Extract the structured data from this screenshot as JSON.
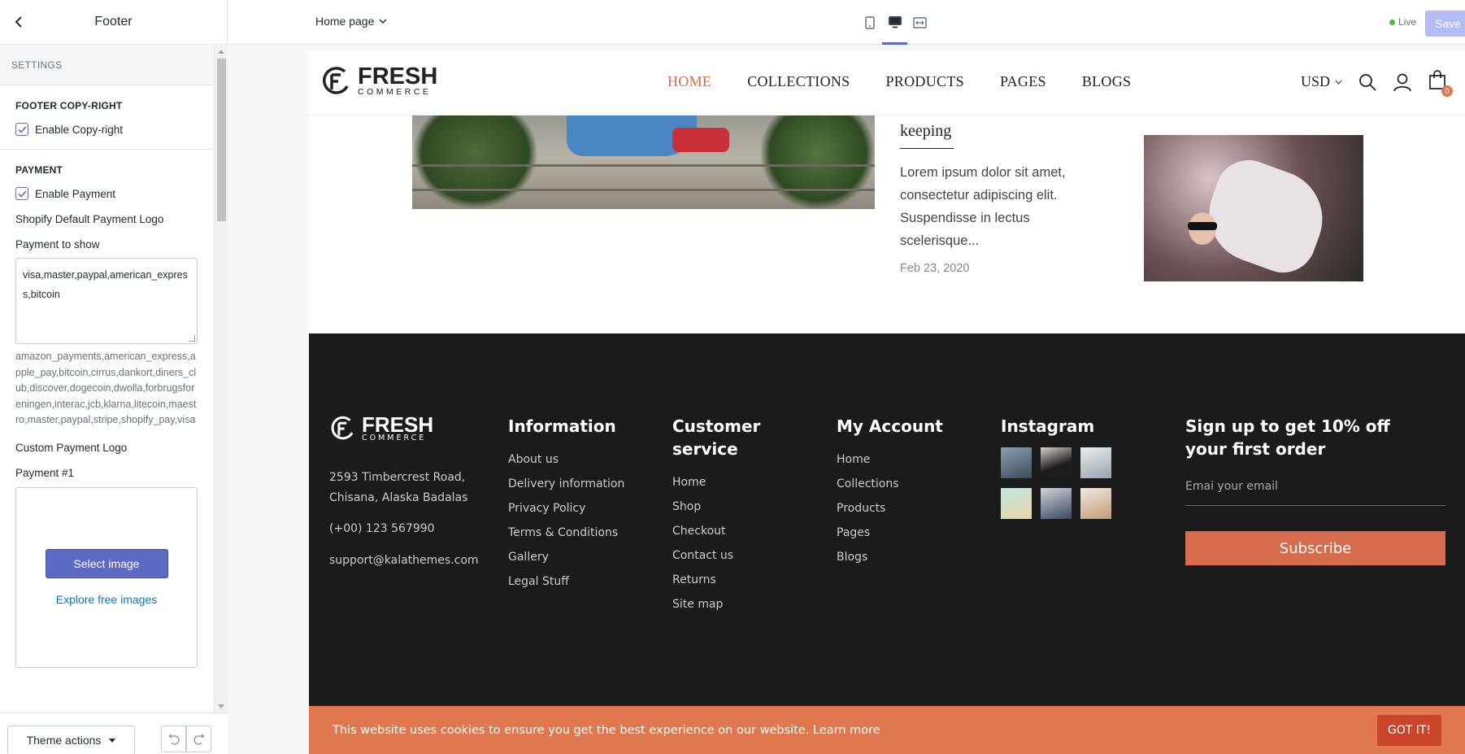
{
  "sidebar": {
    "title": "Footer",
    "settings_label": "SETTINGS",
    "copyright_section": {
      "heading": "FOOTER COPY-RIGHT",
      "checkbox_label": "Enable Copy-right"
    },
    "payment_section": {
      "heading": "PAYMENT",
      "checkbox_label": "Enable Payment",
      "default_logo_label": "Shopify Default Payment Logo",
      "payment_to_show_label": "Payment to show",
      "payment_to_show_value": "visa,master,paypal,american_express,bitcoin",
      "hint": "amazon_payments,american_express,apple_pay,bitcoin,cirrus,dankort,diners_club,discover,dogecoin,dwolla,forbrugsforeningen,interac,jcb,klarna,litecoin,maestro,master,paypal,stripe,shopify_pay,visa",
      "custom_logo_label": "Custom Payment Logo",
      "payment1_label": "Payment #1",
      "select_image": "Select image",
      "explore_images": "Explore free images"
    },
    "theme_actions": "Theme actions"
  },
  "topbar": {
    "page_select": "Home page",
    "live_label": "Live",
    "save_label": "Save"
  },
  "preview": {
    "logo": {
      "big": "FRESH",
      "small": "COMMERCE"
    },
    "menu": [
      "HOME",
      "COLLECTIONS",
      "PRODUCTS",
      "PAGES",
      "BLOGS"
    ],
    "currency": "USD",
    "cart_count": "0",
    "blog": {
      "title": "keeping",
      "excerpt": "Lorem ipsum dolor sit amet, consectetur adipiscing elit. Suspendisse in lectus scelerisque...",
      "date": "Feb 23, 2020"
    },
    "footer": {
      "address": [
        "2593 Timbercrest Road,",
        "Chisana, Alaska Badalas"
      ],
      "phone": "(+00) 123 567990",
      "email": "support@kalathemes.com",
      "information": {
        "heading": "Information",
        "links": [
          "About us",
          "Delivery information",
          "Privacy Policy",
          "Terms & Conditions",
          "Gallery",
          "Legal Stuff"
        ]
      },
      "customer_service": {
        "heading": "Customer service",
        "links": [
          "Home",
          "Shop",
          "Checkout",
          "Contact us",
          "Returns",
          "Site map"
        ]
      },
      "my_account": {
        "heading": "My Account",
        "links": [
          "Home",
          "Collections",
          "Products",
          "Pages",
          "Blogs"
        ]
      },
      "instagram": {
        "heading": "Instagram"
      },
      "signup": {
        "heading": "Sign up to get 10% off your first order",
        "placeholder": "Emai your email",
        "button": "Subscribe"
      }
    },
    "cookie": {
      "text": "This website uses cookies to ensure you get the best experience on our website. Learn more",
      "button": "GOT IT!"
    }
  },
  "colors": {
    "accent": "#5c6ac4",
    "brand_orange": "#d76c4c",
    "footer_bg": "#1c1b1b",
    "cookie_bg": "#e0784f"
  }
}
